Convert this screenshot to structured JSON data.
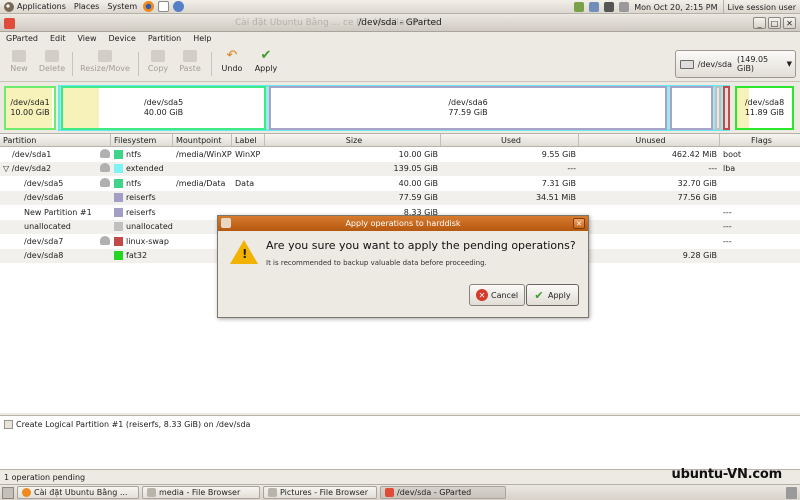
{
  "top_panel": {
    "menus": [
      "Applications",
      "Places",
      "System"
    ],
    "clock": "Mon Oct 20,  2:15 PM",
    "session": "Live session user"
  },
  "window": {
    "title": "/dev/sda - GParted",
    "ghost_title": "Cài đặt Ubuntu Bằng ...                          ce IT - Mozilla Firefox"
  },
  "menubar": [
    "GParted",
    "Edit",
    "View",
    "Device",
    "Partition",
    "Help"
  ],
  "toolbar": {
    "new": "New",
    "delete": "Delete",
    "resize_move": "Resize/Move",
    "copy": "Copy",
    "paste": "Paste",
    "undo": "Undo",
    "apply": "Apply"
  },
  "device_selector": {
    "device": "/dev/sda",
    "size": "(149.05 GiB)"
  },
  "partition_map": {
    "sda1": {
      "name": "/dev/sda1",
      "size": "10.00 GiB",
      "color": "#6ceb6c"
    },
    "sda5": {
      "name": "/dev/sda5",
      "size": "40.00 GiB",
      "color": "#3dea86"
    },
    "sda6": {
      "name": "/dev/sda6",
      "size": "77.59 GiB",
      "color": "#a8a3c8"
    },
    "sda8": {
      "name": "/dev/sda8",
      "size": "11.89 GiB",
      "color": "#2be72b"
    }
  },
  "table": {
    "columns": [
      "Partition",
      "Filesystem",
      "Mountpoint",
      "Label",
      "Size",
      "Used",
      "Unused",
      "Flags"
    ],
    "rows": [
      {
        "partition": "/dev/sda1",
        "key": true,
        "fs": "ntfs",
        "fs_color": "#40d48a",
        "mount": "/media/WinXP",
        "label": "WinXP",
        "size": "10.00 GiB",
        "used": "9.55 GiB",
        "unused": "462.42 MiB",
        "flags": "boot"
      },
      {
        "partition": "/dev/sda2",
        "key": true,
        "fs": "extended",
        "fs_color": "#7ff3f3",
        "mount": "",
        "label": "",
        "size": "139.05 GiB",
        "used": "---",
        "unused": "---",
        "flags": "lba"
      },
      {
        "partition": "/dev/sda5",
        "key": true,
        "fs": "ntfs",
        "fs_color": "#40d48a",
        "mount": "/media/Data",
        "label": "Data",
        "size": "40.00 GiB",
        "used": "7.31 GiB",
        "unused": "32.70 GiB",
        "flags": ""
      },
      {
        "partition": "/dev/sda6",
        "key": false,
        "fs": "reiserfs",
        "fs_color": "#a29ec4",
        "mount": "",
        "label": "",
        "size": "77.59 GiB",
        "used": "34.51 MiB",
        "unused": "77.56 GiB",
        "flags": ""
      },
      {
        "partition": "New Partition #1",
        "key": false,
        "fs": "reiserfs",
        "fs_color": "#a29ec4",
        "mount": "",
        "label": "",
        "size": "8.33 GiB",
        "used": "",
        "unused": "",
        "flags": "---"
      },
      {
        "partition": "unallocated",
        "key": false,
        "fs": "unallocated",
        "fs_color": "#c0c0c0",
        "mount": "",
        "label": "",
        "size": "",
        "used": "",
        "unused": "",
        "flags": "---"
      },
      {
        "partition": "/dev/sda7",
        "key": true,
        "fs": "linux-swap",
        "fs_color": "#c44a4a",
        "mount": "",
        "label": "",
        "size": "",
        "used": "",
        "unused": "",
        "flags": "---"
      },
      {
        "partition": "/dev/sda8",
        "key": false,
        "fs": "fat32",
        "fs_color": "#22d622",
        "mount": "",
        "label": "",
        "size": "",
        "used": "",
        "unused": "9.28 GiB",
        "flags": ""
      }
    ]
  },
  "dialog": {
    "title": "Apply operations to harddisk",
    "heading": "Are you sure you want to apply the pending operations?",
    "message": "It is recommended to backup valuable data before proceeding.",
    "cancel": "Cancel",
    "apply": "Apply"
  },
  "pending": {
    "operation": "Create Logical Partition #1 (reiserfs, 8.33 GiB) on /dev/sda",
    "status": "1 operation pending"
  },
  "watermark": "ubuntu-VN.com",
  "taskbar": [
    "Cài đặt Ubuntu Bằng ...",
    "media - File Browser",
    "Pictures - File Browser",
    "/dev/sda - GParted"
  ]
}
